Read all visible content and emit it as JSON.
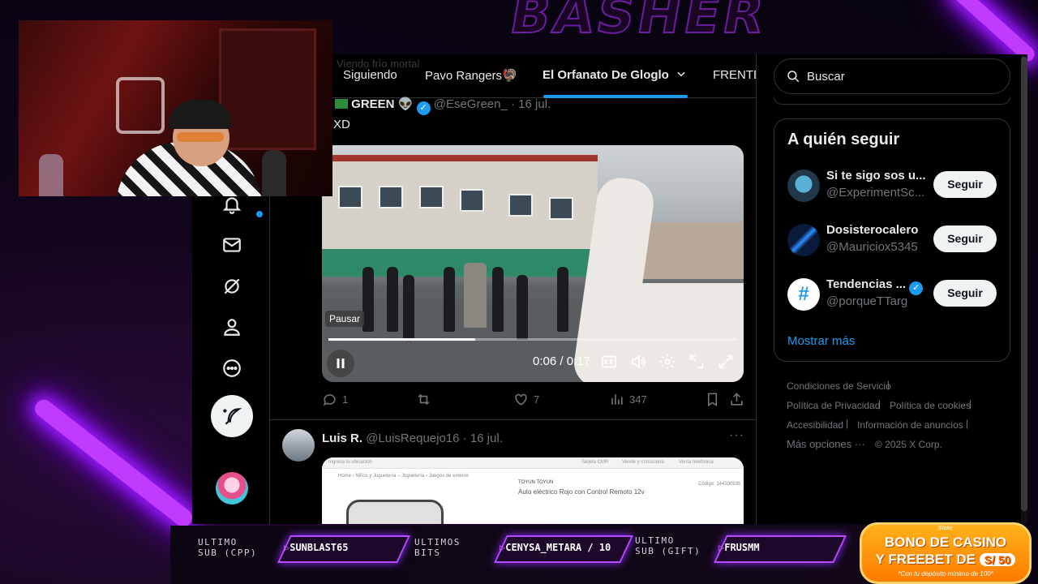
{
  "overlay": {
    "brand": "BASHER",
    "bottom": {
      "sub_cpp_label": "ULTIMO\nSUB (CPP)",
      "sub_cpp_value": "SUNBLAST65",
      "bits_label": "ULTIMOS\nBITS",
      "bits_value": "CENYSA_METARA / 10",
      "sub_gift_label": "ULTIMO\nSUB (GIFT)",
      "sub_gift_value": "FRUSMM"
    },
    "casino": {
      "brand": "Stake",
      "line1": "BONO DE CASINO",
      "line2": "Y FREEBET DE",
      "badge": "S/ 50",
      "line3": "*Con tu depósito mínimo de 100*"
    }
  },
  "tabs": {
    "faded": "Viendo frío mortal",
    "items": [
      "Siguiendo",
      "Pavo Rangers🦃",
      "El Orfanato De Gloglo",
      "FRENTE"
    ]
  },
  "tweet1": {
    "name": "GREEN",
    "handle": "@EseGreen_",
    "date": "· 16 jul.",
    "text": "XD",
    "video": {
      "pause_label": "Pausar",
      "time": "0:06 / 0:17",
      "progress": 0.36
    },
    "replies": "1",
    "likes": "7",
    "views": "347"
  },
  "tweet2": {
    "name": "Luis R.",
    "handle": "@LuisRequejo16",
    "date": "· 16 jul.",
    "more": "···",
    "shot": {
      "location": "Ingresa tu ubicación",
      "tarjeta": "Tarjeta CMR",
      "vende": "Vende y consiciona",
      "venta": "Venta telefónica",
      "breadcrumb": "Home  ›  Niños y Juguetería – Juguetería  ›  Juegos de exterior",
      "brand": "TOYUN TOYUN",
      "title": "Auto eléctrico Rojo con Control Remoto 12v",
      "code": "Código: 144330935"
    }
  },
  "right": {
    "search_placeholder": "Buscar",
    "follow_title": "A quién seguir",
    "follows": [
      {
        "name": "Si te sigo sos u...",
        "handle": "@ExperimentSc...",
        "button": "Seguir"
      },
      {
        "name": "Dosisterocalero",
        "handle": "@Mauriciox5345",
        "button": "Seguir"
      },
      {
        "name": "Tendencias ...",
        "handle": "@porqueTTarg",
        "button": "Seguir"
      }
    ],
    "show_more": "Mostrar más",
    "footer": {
      "terms": "Condiciones de Servicio",
      "privacy": "Política de Privacidad",
      "cookies": "Política de cookies",
      "accessibility": "Accesibilidad",
      "ads": "Información de anuncios",
      "more": "Más opciones ···",
      "copyright": "© 2025 X Corp."
    }
  },
  "colors": {
    "accent": "#1d9bf0",
    "neon": "#c13bff",
    "casino": "#ff8a00"
  }
}
